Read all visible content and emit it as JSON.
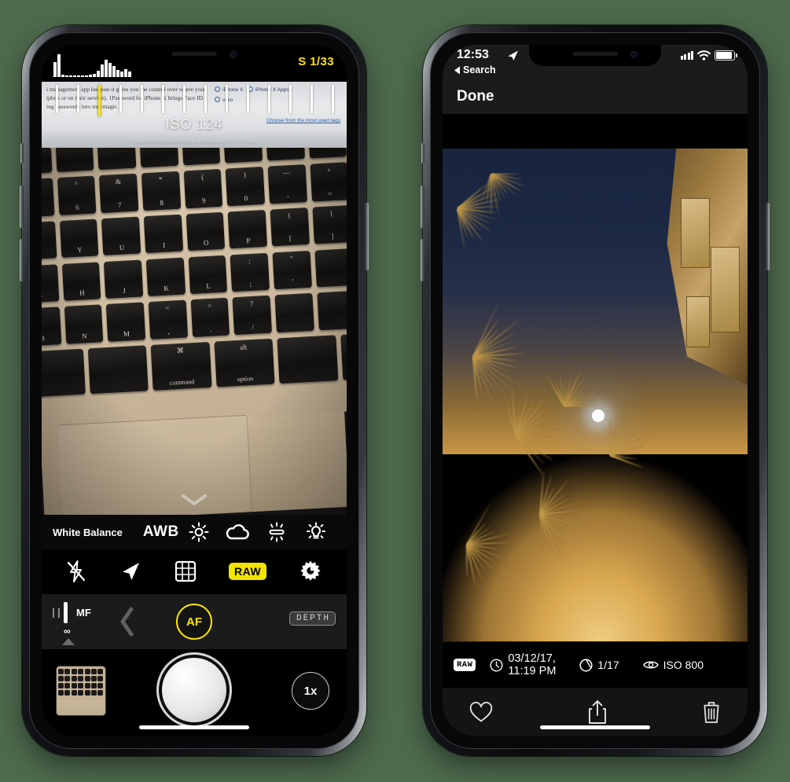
{
  "background_color": "#4e6b4e",
  "left_phone": {
    "app": "manual-camera",
    "topbar": {
      "shutter_speed": "S 1/33",
      "histogram_icon": "histogram-icon",
      "histogram_bars": [
        62,
        96,
        10,
        8,
        7,
        7,
        6,
        7,
        8,
        10,
        14,
        26,
        52,
        74,
        60,
        46,
        30,
        22,
        34,
        24
      ]
    },
    "viewfinder": {
      "iso_readout": "ISO 124",
      "exposure_marker_index": 2,
      "note_text_lines": [
        "i management app because it gives you the control over where your",
        "ipbox or on their service). 1Password for iPhone X brings Face ID",
        "ing passwords into true magic."
      ],
      "note_tags": [
        "iPhone X",
        "iPhone X Apps",
        "vsco"
      ],
      "note_link": "Choose from the most used tags",
      "note_footer": "Last edited by Khamosh Pathak on December 4, 2017 at 7:21 am",
      "chevron_icon": "chevron-down-icon"
    },
    "white_balance": {
      "label": "White Balance",
      "auto_label": "AWB",
      "presets": [
        "sun-icon",
        "cloud-icon",
        "fluorescent-icon",
        "incandescent-icon"
      ]
    },
    "toggles": [
      {
        "name": "flash-off-icon",
        "active": false
      },
      {
        "name": "location-icon",
        "active": false
      },
      {
        "name": "grid-icon",
        "active": false
      },
      {
        "name": "raw-badge",
        "label": "RAW",
        "active": true
      },
      {
        "name": "settings-gear-icon",
        "active": false
      }
    ],
    "focus": {
      "mode_label": "MF",
      "infinity_label": "∞",
      "af_label": "AF",
      "depth_label": "DEPTH",
      "prev_icon": "chevron-left-icon"
    },
    "shoot": {
      "thumbnail_name": "last-photo-thumbnail",
      "shutter_name": "shutter-button",
      "zoom_label": "1x"
    }
  },
  "right_phone": {
    "app": "photo-viewer",
    "status_bar": {
      "time": "12:53",
      "location_icon": "location-arrow-icon",
      "back_label": "Search",
      "back_icon": "back-triangle-icon",
      "signal_icon": "cellular-signal-icon",
      "signal_bars": [
        5,
        7,
        9,
        11
      ],
      "wifi_icon": "wifi-icon",
      "battery_icon": "battery-icon",
      "battery_level": 84
    },
    "navbar": {
      "done_label": "Done"
    },
    "photo": {
      "name": "night-photo-palm-trees-moon",
      "description": "Night scene with palm trees, a bright moon and orange haze"
    },
    "metadata": {
      "format_badge": "RAW",
      "clock_icon": "clock-icon",
      "date": "03/12/17,",
      "time": "11:19 PM",
      "aperture_icon": "aperture-icon",
      "shutter": "1/17",
      "iso_icon": "eye-icon",
      "iso": "ISO 800"
    },
    "toolbar": [
      {
        "name": "favorite-heart-icon",
        "label": ""
      },
      {
        "name": "share-icon",
        "label": ""
      },
      {
        "name": "delete-trash-icon",
        "label": ""
      }
    ]
  }
}
